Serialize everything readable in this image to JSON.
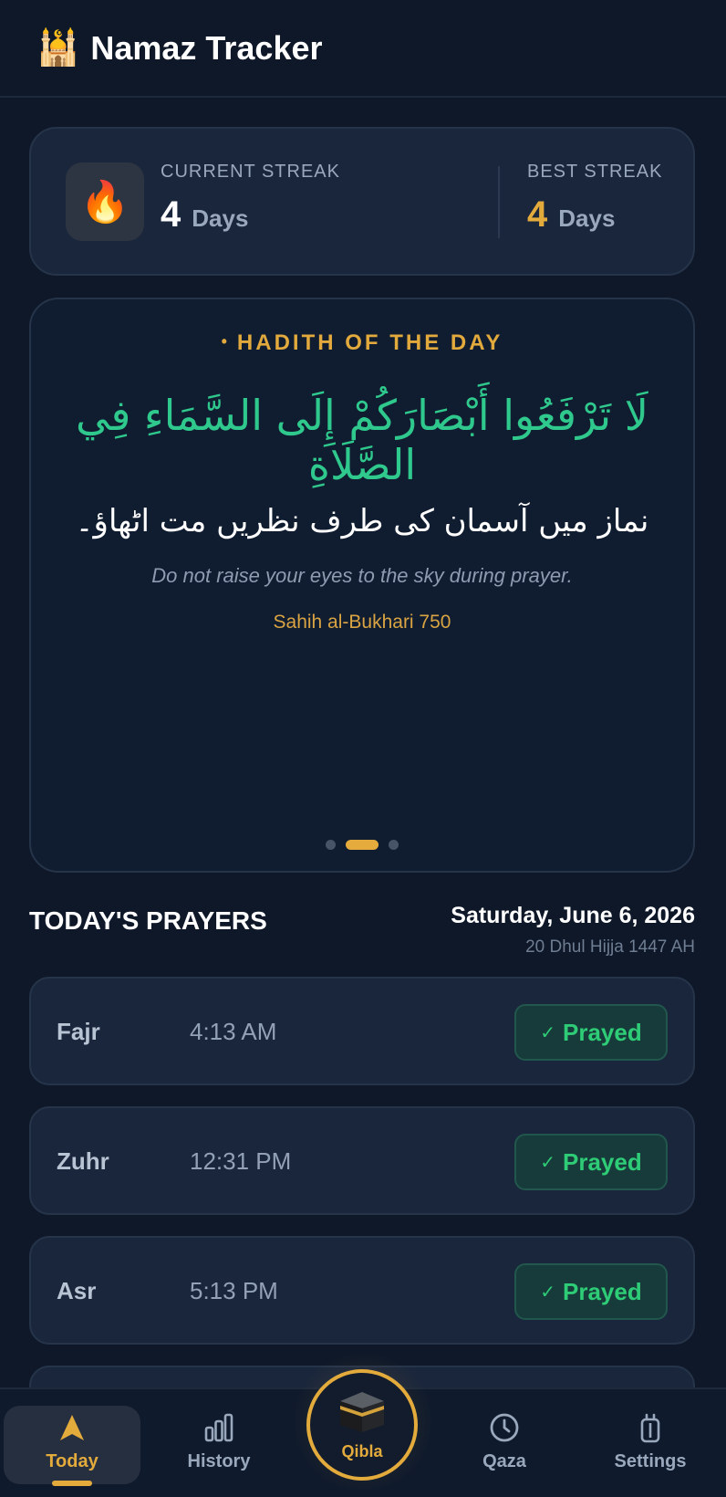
{
  "header": {
    "logo": "🕌",
    "title": "Namaz Tracker"
  },
  "streak": {
    "icon": "🔥",
    "current_label": "CURRENT STREAK",
    "current_value": "4",
    "current_unit": "Days",
    "best_label": "BEST STREAK",
    "best_value": "4",
    "best_unit": "Days"
  },
  "hadith": {
    "header_dot": "•",
    "header": "HADITH OF THE DAY",
    "arabic": "لَا تَرْفَعُوا أَبْصَارَكُمْ إِلَى السَّمَاءِ فِي الصَّلَاةِ",
    "urdu": "نماز میں آسمان کی طرف نظریں مت اٹھاؤ۔",
    "english": "Do not raise your eyes to the sky during prayer.",
    "source": "Sahih al-Bukhari 750",
    "pager": {
      "count": 3,
      "active_index": 1
    }
  },
  "today": {
    "title": "TODAY'S PRAYERS",
    "date": "Saturday, June 6, 2026",
    "hijri": "20 Dhul Hijja 1447 AH"
  },
  "prayers": [
    {
      "name": "Fajr",
      "time": "4:13 AM",
      "status": "Prayed",
      "check": "✓"
    },
    {
      "name": "Zuhr",
      "time": "12:31 PM",
      "status": "Prayed",
      "check": "✓"
    },
    {
      "name": "Asr",
      "time": "5:13 PM",
      "status": "Prayed",
      "check": "✓"
    }
  ],
  "nav": {
    "today": "Today",
    "history": "History",
    "qibla": "Qibla",
    "qaza": "Qaza",
    "settings": "Settings"
  },
  "colors": {
    "background": "#0e1829",
    "card": "#1a263b",
    "accent": "#e3aa3c",
    "arabic_green": "#2fc98d",
    "prayed_green": "#2ecc76"
  }
}
